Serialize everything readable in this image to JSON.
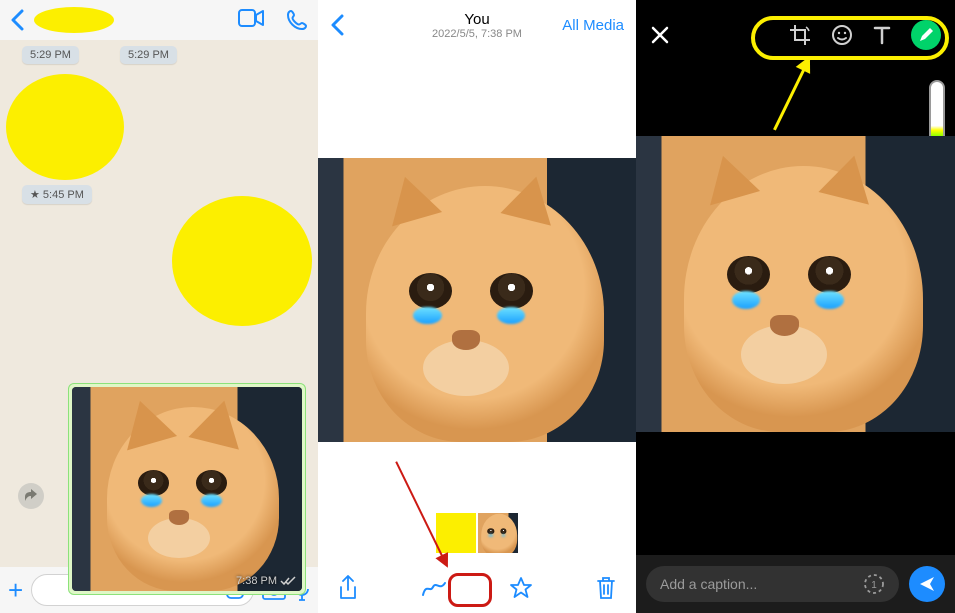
{
  "panel1": {
    "timestamps": {
      "t1": "5:29 PM",
      "t2": "5:29 PM",
      "t3": "5:45 PM"
    },
    "photo_time": "7:38 PM"
  },
  "panel2": {
    "title": "You",
    "date": "2022/5/5, 7:38 PM",
    "all_media": "All Media"
  },
  "panel3": {
    "caption_placeholder": "Add a caption..."
  }
}
